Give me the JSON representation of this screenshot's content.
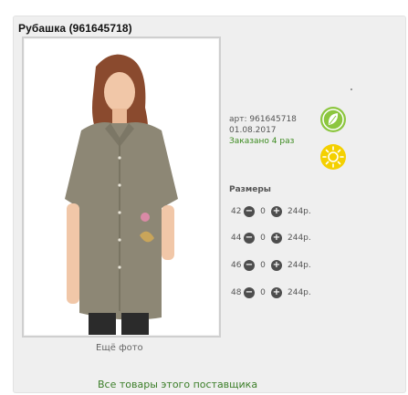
{
  "product": {
    "title": "Рубашка (961645718)",
    "art": "арт: 961645718",
    "date": "01.08.2017",
    "ordered": "Заказано 4 раз"
  },
  "badges": [
    {
      "icon": "leaf-icon",
      "color": "#8cc63f"
    },
    {
      "icon": "sun-icon",
      "color": "#f4d000"
    }
  ],
  "sizes": {
    "title": "Размеры",
    "rows": [
      {
        "size": "42",
        "qty": "0",
        "price": "244р."
      },
      {
        "size": "44",
        "qty": "0",
        "price": "244р."
      },
      {
        "size": "46",
        "qty": "0",
        "price": "244р."
      },
      {
        "size": "48",
        "qty": "0",
        "price": "244р."
      }
    ]
  },
  "more_photo": "Ещё фото",
  "supplier_link": "Все товары этого поставщика",
  "colors": {
    "accent_green": "#3c8b1f",
    "shirt": "#8d8775"
  }
}
